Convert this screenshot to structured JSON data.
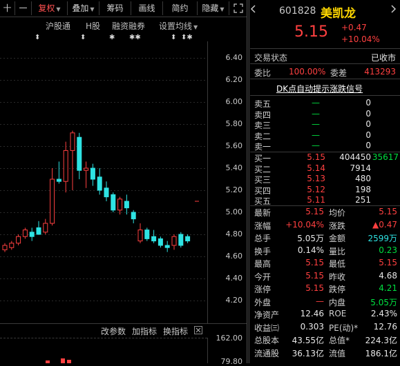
{
  "toolbar": {
    "items": [
      {
        "label": "十"
      },
      {
        "label": "一"
      },
      {
        "label": "复权"
      },
      {
        "label": "叠加"
      },
      {
        "label": "筹码"
      },
      {
        "label": "画线"
      },
      {
        "label": "简约"
      },
      {
        "label": "隐藏"
      }
    ]
  },
  "sub_toolbar": {
    "hgt": "沪股通",
    "hgu": "H股",
    "margin": "融资融券",
    "ma": "设置均线"
  },
  "markers": [
    "⬍",
    "⬍",
    "✱",
    "✱✱",
    "⬍",
    "⬍✱"
  ],
  "price_axis": [
    "6.40",
    "6.20",
    "6.00",
    "5.80",
    "5.60",
    "5.40",
    "5.20",
    "5.00",
    "4.80",
    "4.60",
    "4.40",
    "4.20"
  ],
  "indicator_bar": {
    "change_param": "改参数",
    "add_indicator": "加指标",
    "switch_indicator": "换指标"
  },
  "volume_axis": {
    "top": "162.00",
    "bottom": "79.80"
  },
  "colors": {
    "up": "#ff4040",
    "down": "#2ee3e3",
    "neutral": "#e8e8e8",
    "green": "#00e040",
    "yellow": "#ffd800"
  },
  "chart_data": {
    "type": "candlestick",
    "ylim": [
      4.2,
      6.4
    ],
    "candles": [
      {
        "o": 4.66,
        "h": 4.72,
        "l": 4.64,
        "c": 4.7
      },
      {
        "o": 4.68,
        "h": 4.74,
        "l": 4.66,
        "c": 4.72
      },
      {
        "o": 4.72,
        "h": 4.8,
        "l": 4.7,
        "c": 4.78
      },
      {
        "o": 4.78,
        "h": 4.86,
        "l": 4.76,
        "c": 4.84
      },
      {
        "o": 4.82,
        "h": 4.86,
        "l": 4.74,
        "c": 4.78
      },
      {
        "o": 4.86,
        "h": 4.92,
        "l": 4.8,
        "c": 4.8
      },
      {
        "o": 4.82,
        "h": 4.94,
        "l": 4.8,
        "c": 4.9
      },
      {
        "o": 4.9,
        "h": 5.4,
        "l": 4.88,
        "c": 5.3
      },
      {
        "o": 5.3,
        "h": 5.46,
        "l": 5.26,
        "c": 5.28
      },
      {
        "o": 5.28,
        "h": 5.64,
        "l": 5.18,
        "c": 5.56
      },
      {
        "o": 5.56,
        "h": 5.74,
        "l": 5.2,
        "c": 5.72
      },
      {
        "o": 5.68,
        "h": 5.72,
        "l": 5.3,
        "c": 5.38
      },
      {
        "o": 5.38,
        "h": 5.46,
        "l": 5.22,
        "c": 5.4
      },
      {
        "o": 5.4,
        "h": 5.44,
        "l": 5.24,
        "c": 5.3
      },
      {
        "o": 5.32,
        "h": 5.4,
        "l": 5.16,
        "c": 5.2
      },
      {
        "o": 5.22,
        "h": 5.28,
        "l": 5.1,
        "c": 5.14
      },
      {
        "o": 5.16,
        "h": 5.18,
        "l": 5.0,
        "c": 5.02
      },
      {
        "o": 5.02,
        "h": 5.14,
        "l": 4.98,
        "c": 5.12
      },
      {
        "o": 5.1,
        "h": 5.16,
        "l": 4.98,
        "c": 5.04
      },
      {
        "o": 5.0,
        "h": 5.02,
        "l": 4.9,
        "c": 4.94
      },
      {
        "o": 4.74,
        "h": 4.9,
        "l": 4.72,
        "c": 4.84
      },
      {
        "o": 4.84,
        "h": 4.86,
        "l": 4.74,
        "c": 4.76
      },
      {
        "o": 4.78,
        "h": 4.84,
        "l": 4.72,
        "c": 4.74
      },
      {
        "o": 4.76,
        "h": 4.78,
        "l": 4.68,
        "c": 4.7
      },
      {
        "o": 4.7,
        "h": 4.74,
        "l": 4.64,
        "c": 4.68
      },
      {
        "o": 4.7,
        "h": 4.8,
        "l": 4.66,
        "c": 4.78
      },
      {
        "o": 4.8,
        "h": 4.82,
        "l": 4.68,
        "c": 4.7
      },
      {
        "o": 4.78,
        "h": 4.8,
        "l": 4.72,
        "c": 4.74
      }
    ],
    "last_price_marker": 5.15
  },
  "panel": {
    "code": "601828",
    "name": "美凯龙",
    "price": "5.15",
    "change": "+0.47",
    "change_pct": "+10.04%",
    "status_label": "交易状态",
    "status_value": "已收市",
    "weibi_label": "委比",
    "weibi_value": "100.00%",
    "weicha_label": "委差",
    "weicha_value": "413293",
    "signal_link": "DK点自动提示涨跌信号",
    "sells": [
      {
        "label": "卖五",
        "price": "—",
        "vol": "0"
      },
      {
        "label": "卖四",
        "price": "—",
        "vol": "0"
      },
      {
        "label": "卖三",
        "price": "—",
        "vol": "0"
      },
      {
        "label": "卖二",
        "price": "—",
        "vol": "0"
      },
      {
        "label": "卖一",
        "price": "—",
        "vol": "0"
      }
    ],
    "buys": [
      {
        "label": "买一",
        "price": "5.15",
        "vol": "404450",
        "extra": "35617"
      },
      {
        "label": "买二",
        "price": "5.14",
        "vol": "7914",
        "extra": ""
      },
      {
        "label": "买三",
        "price": "5.13",
        "vol": "480",
        "extra": ""
      },
      {
        "label": "买四",
        "price": "5.12",
        "vol": "198",
        "extra": ""
      },
      {
        "label": "买五",
        "price": "5.11",
        "vol": "251",
        "extra": ""
      }
    ],
    "stats": [
      [
        {
          "l": "最新",
          "v": "5.15",
          "c": "red"
        },
        {
          "l": "均价",
          "v": "5.15",
          "c": "red"
        }
      ],
      [
        {
          "l": "涨幅",
          "v": "+10.04%",
          "c": "red"
        },
        {
          "l": "涨跌",
          "v": "▲0.47",
          "c": "red"
        }
      ],
      [
        {
          "l": "总手",
          "v": "5.05万",
          "c": "white"
        },
        {
          "l": "金额",
          "v": "2599万",
          "c": "cyan"
        }
      ],
      [
        {
          "l": "换手",
          "v": "0.14%",
          "c": "white"
        },
        {
          "l": "量比",
          "v": "0.23",
          "c": "green"
        }
      ],
      [
        {
          "l": "最高",
          "v": "5.15",
          "c": "red"
        },
        {
          "l": "最低",
          "v": "5.15",
          "c": "red"
        }
      ],
      [
        {
          "l": "今开",
          "v": "5.15",
          "c": "red"
        },
        {
          "l": "昨收",
          "v": "4.68",
          "c": "white"
        }
      ],
      [
        {
          "l": "涨停",
          "v": "5.15",
          "c": "red"
        },
        {
          "l": "跌停",
          "v": "4.21",
          "c": "green"
        }
      ],
      [
        {
          "l": "外盘",
          "v": "—",
          "c": "red"
        },
        {
          "l": "内盘",
          "v": "5.05万",
          "c": "green"
        }
      ],
      [
        {
          "l": "净资产",
          "v": "12.46",
          "c": "white"
        },
        {
          "l": "ROE",
          "v": "2.43%",
          "c": "white"
        }
      ],
      [
        {
          "l": "收益㈢",
          "v": "0.303",
          "c": "white"
        },
        {
          "l": "PE(动)*",
          "v": "12.76",
          "c": "white"
        }
      ],
      [
        {
          "l": "总股本",
          "v": "43.55亿",
          "c": "white"
        },
        {
          "l": "总值*",
          "v": "224.3亿",
          "c": "white"
        }
      ],
      [
        {
          "l": "流通股",
          "v": "36.13亿",
          "c": "white"
        },
        {
          "l": "流值",
          "v": "186.1亿",
          "c": "white"
        }
      ]
    ]
  }
}
